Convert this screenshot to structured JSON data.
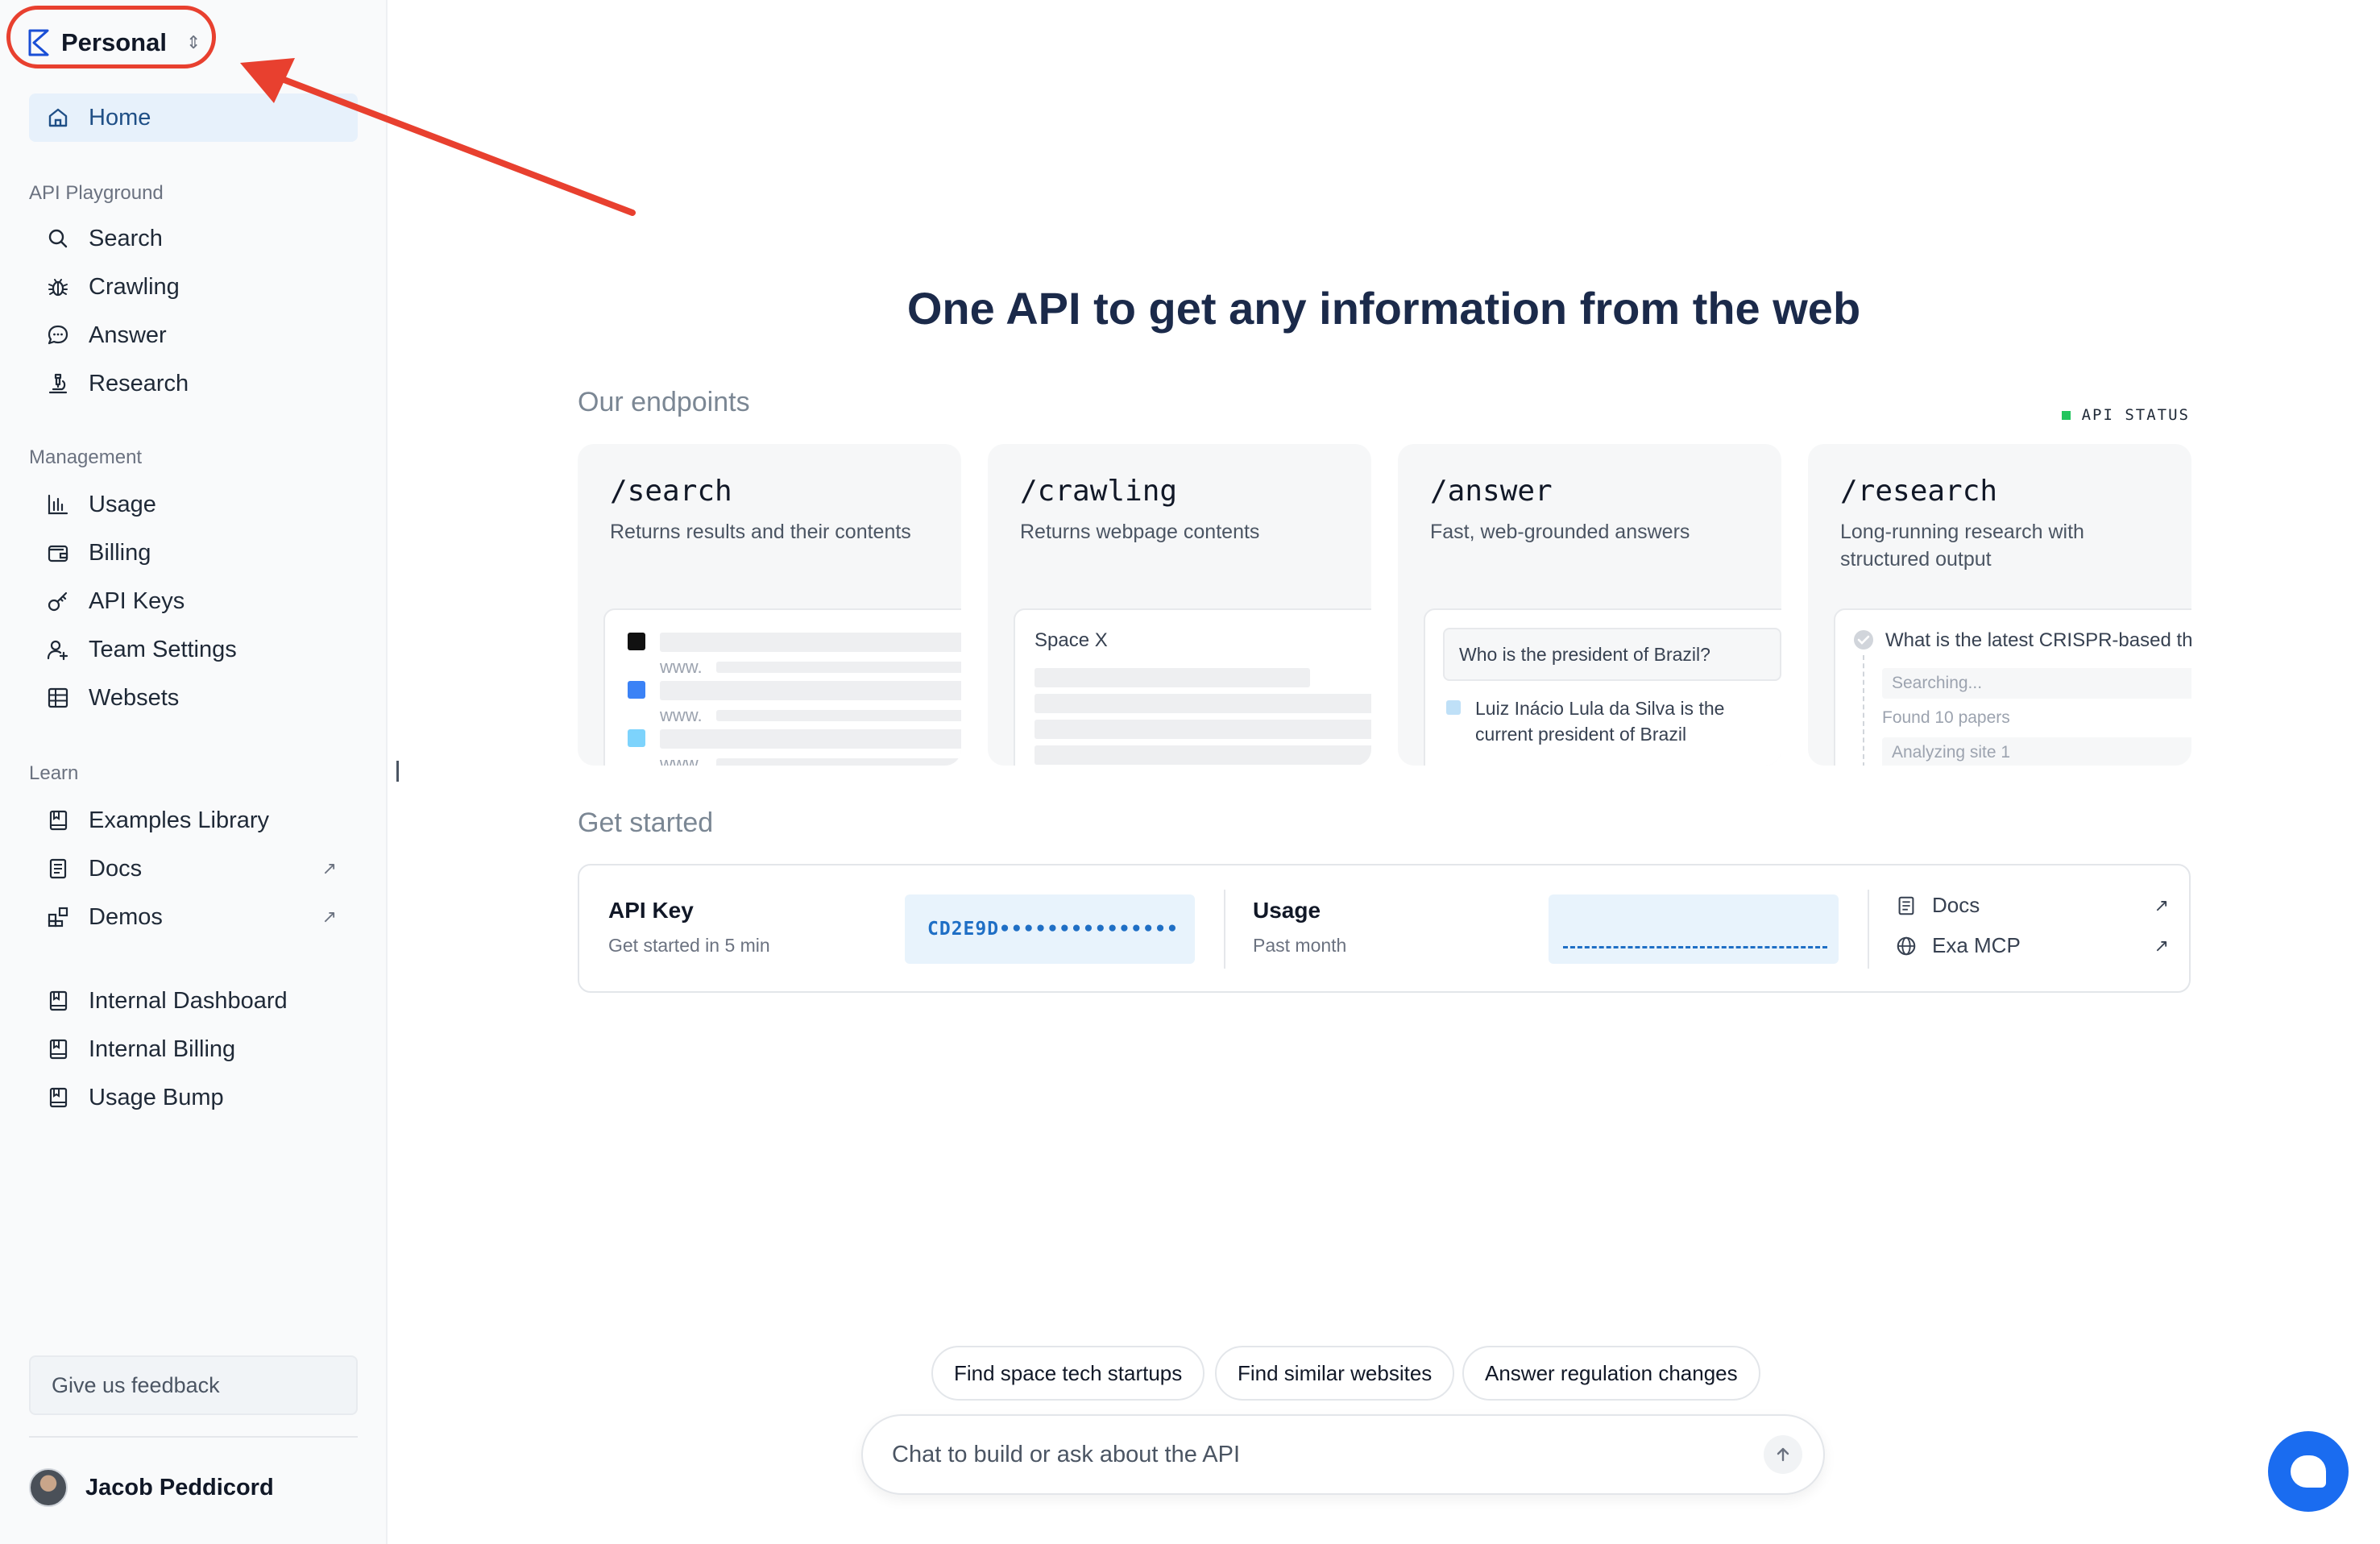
{
  "workspace": {
    "name": "Personal"
  },
  "sidebar": {
    "home": "Home",
    "sections": {
      "playground": "API Playground",
      "management": "Management",
      "learn": "Learn"
    },
    "playground_items": [
      "Search",
      "Crawling",
      "Answer",
      "Research"
    ],
    "management_items": [
      "Usage",
      "Billing",
      "API Keys",
      "Team Settings",
      "Websets"
    ],
    "learn_items": [
      "Examples Library",
      "Docs",
      "Demos"
    ],
    "internal_items": [
      "Internal Dashboard",
      "Internal Billing",
      "Usage Bump"
    ],
    "feedback": "Give us feedback",
    "user": "Jacob Peddicord"
  },
  "main": {
    "hero": "One API to get any information from the web",
    "endpoints_title": "Our endpoints",
    "api_status": "API STATUS",
    "endpoints": [
      {
        "title": "/search",
        "desc": "Returns results and their contents"
      },
      {
        "title": "/crawling",
        "desc": "Returns webpage contents"
      },
      {
        "title": "/answer",
        "desc": "Fast, web-grounded answers"
      },
      {
        "title": "/research",
        "desc": "Long-running research with structured output"
      }
    ],
    "search_preview": {
      "www": "www."
    },
    "crawling_preview": {
      "query": "Space X"
    },
    "answer_preview": {
      "question": "Who is the president of Brazil?",
      "answer": "Luiz Inácio Lula da Silva is the current president of Brazil"
    },
    "research_preview": {
      "question": "What is the latest CRISPR-based the",
      "steps": [
        "Searching...",
        "Found 10 papers",
        "Analyzing site 1"
      ]
    },
    "get_started": {
      "title": "Get started",
      "api_key_label": "API Key",
      "api_key_sub": "Get started in 5 min",
      "api_key_value": "CD2E9D•••••••••••••••",
      "usage_label": "Usage",
      "usage_sub": "Past month",
      "links": [
        "Docs",
        "Exa MCP"
      ]
    },
    "suggestions": [
      "Find space tech startups",
      "Find similar websites",
      "Answer regulation changes"
    ],
    "chat_placeholder": "Chat to build or ask about the API"
  },
  "colors": {
    "accent": "#1a6cf0",
    "annotation": "#e8402f",
    "status_green": "#22c55e",
    "active_nav_bg": "#e7f1fb"
  }
}
